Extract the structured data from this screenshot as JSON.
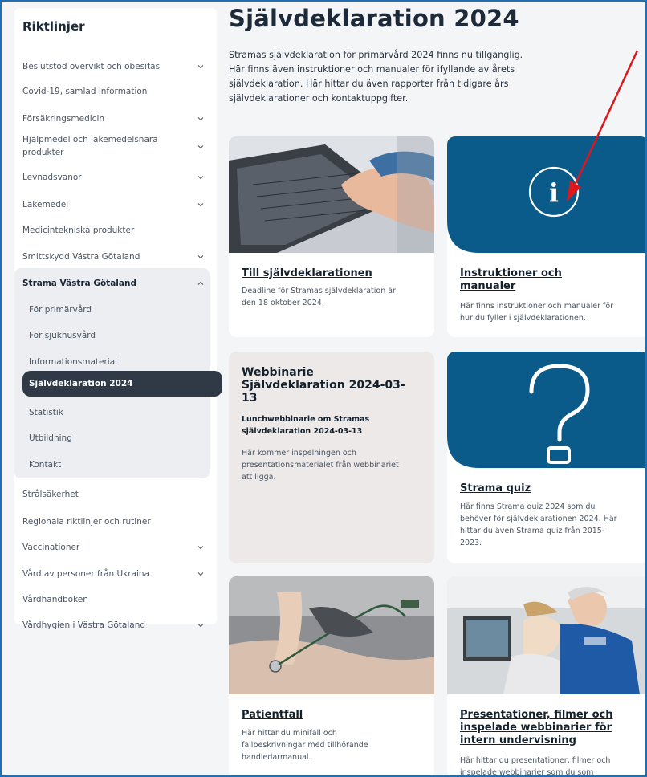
{
  "sidebar": {
    "title": "Riktlinjer",
    "items": [
      {
        "label": "Beslutstöd övervikt och obesitas"
      },
      {
        "label": "Covid-19, samlad information"
      },
      {
        "label": "Försäkringsmedicin"
      },
      {
        "label": "Hjälpmedel och läkemedelsnära"
      },
      {
        "label": "produkter"
      },
      {
        "label": "Levnadsvanor"
      },
      {
        "label": "Läkemedel"
      },
      {
        "label": "Medicintekniska produkter"
      },
      {
        "label": "Smittskydd Västra Götaland"
      },
      {
        "label": "Strama Västra Götaland"
      },
      {
        "label": "För primärvård"
      },
      {
        "label": "För sjukhusvård"
      },
      {
        "label": "Informationsmaterial"
      },
      {
        "label": "Självdeklaration 2024"
      },
      {
        "label": "Statistik"
      },
      {
        "label": "Utbildning"
      },
      {
        "label": "Kontakt"
      },
      {
        "label": "Strålsäkerhet"
      },
      {
        "label": "Regionala riktlinjer och rutiner"
      },
      {
        "label": "Vaccinationer"
      },
      {
        "label": "Vård av personer från Ukraina"
      },
      {
        "label": "Vårdhandboken"
      },
      {
        "label": "Vårdhygien i Västra Götaland"
      }
    ]
  },
  "main": {
    "title": "Självdeklaration 2024",
    "intro": [
      "Stramas självdeklaration för primärvård 2024 finns nu tillgänglig.",
      "Här finns även instruktioner och manualer för ifyllande av årets",
      "självdeklaration. Här hittar du även rapporter från tidigare års",
      "självdeklarationer och kontaktuppgifter."
    ],
    "cards": [
      {
        "title": [
          "Till självdeklarationen"
        ],
        "desc": [
          "Deadline för Stramas självdeklaration är",
          "den 18 oktober 2024."
        ]
      },
      {
        "title": [
          "Instruktioner och",
          "manualer"
        ],
        "desc": [
          "Här finns instruktioner och manualer för",
          "hur du fyller i självdeklarationen."
        ]
      },
      {
        "title": [
          "Webbinarie",
          "Självdeklaration 2024-03-",
          "13"
        ],
        "sub": [
          "Lunchwebbinarie om Stramas",
          "självdeklaration 2024-03-13"
        ],
        "desc": [
          "Här kommer inspelningen och",
          "presentationsmaterialet från webbinariet",
          "att ligga."
        ]
      },
      {
        "title": [
          "Strama quiz"
        ],
        "desc": [
          "Här finns Strama quiz 2024 som du",
          "behöver för självdeklarationen 2024. Här",
          "hittar du även Strama quiz från 2015-",
          "2023."
        ]
      },
      {
        "title": [
          "Patientfall"
        ],
        "desc": [
          "Här hittar du minifall och",
          "fallbeskrivningar med tillhörande",
          "handledarmanual."
        ]
      },
      {
        "title": [
          "Presentationer, filmer och",
          "inspelade webbinarier för",
          "intern undervisning"
        ],
        "desc": [
          "Här hittar du presentationer, filmer och",
          "inspelade webbinarier som du som"
        ]
      }
    ]
  },
  "colors": {
    "accent_blue": "#0a5a8a",
    "active_nav": "#2f3a46",
    "arrow": "#e0161b"
  }
}
